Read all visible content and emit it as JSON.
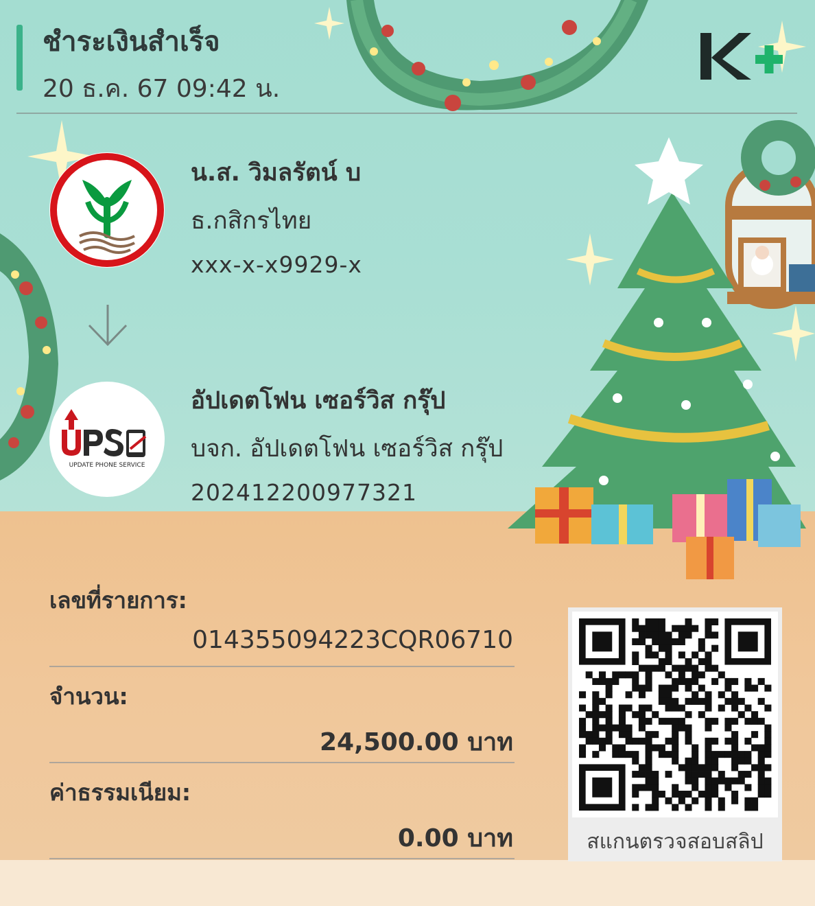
{
  "header": {
    "title": "ชำระเงินสำเร็จ",
    "datetime": "20 ธ.ค. 67  09:42 น.",
    "brand_logo": "K+"
  },
  "sender": {
    "name": "น.ส. วิมลรัตน์ บ",
    "bank": "ธ.กสิกรไทย",
    "account": "xxx-x-x9929-x",
    "logo_icon": "kbank-logo-icon"
  },
  "receiver": {
    "name": "อัปเดตโฟน เซอร์วิส กรุ๊ป",
    "company": "บจก. อัปเดตโฟน เซอร์วิส กรุ๊ป",
    "account": "202412200977321",
    "logo_icon": "ups-logo-icon",
    "logo_text": "UPS",
    "logo_subtext": "UPDATE PHONE SERVICE"
  },
  "details": {
    "ref_label": "เลขที่รายการ:",
    "ref_value": "014355094223CQR06710",
    "amount_label": "จำนวน:",
    "amount_value": "24,500.00 บาท",
    "fee_label": "ค่าธรรมเนียม:",
    "fee_value": "0.00 บาท"
  },
  "qr": {
    "caption": "สแกนตรวจสอบสลิป"
  },
  "colors": {
    "accent": "#3bb28a",
    "kplus_dark": "#1f2a28",
    "kplus_green": "#1fb36b",
    "kbank_red": "#d7141a",
    "kbank_green": "#0a9a3f",
    "ups_red": "#c9171e"
  }
}
